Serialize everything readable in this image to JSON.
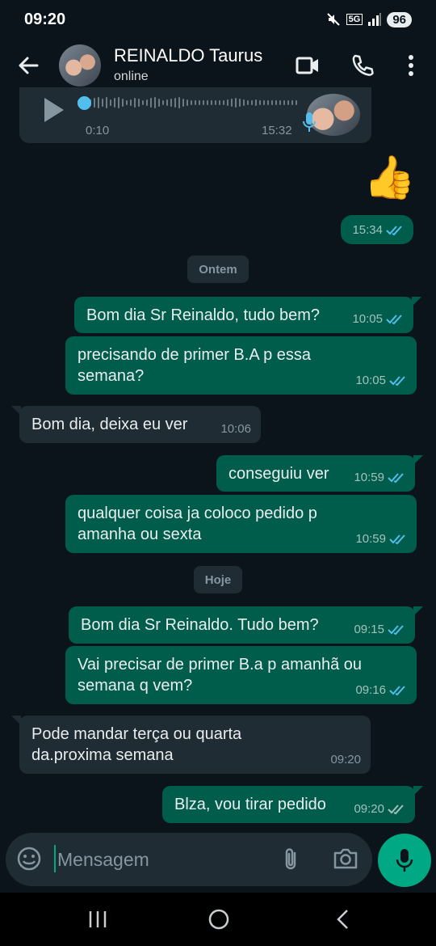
{
  "status_bar": {
    "time": "09:20",
    "network": "5G",
    "battery": "96"
  },
  "header": {
    "contact_name": "REINALDO Taurus",
    "contact_status": "online"
  },
  "audio_message": {
    "duration": "0:10",
    "time": "15:32"
  },
  "emoji_message": {
    "emoji": "👍",
    "time": "15:34"
  },
  "date_separators": {
    "yesterday": "Ontem",
    "today": "Hoje"
  },
  "messages": [
    {
      "text": "Bom dia Sr Reinaldo, tudo bem?",
      "time": "10:05",
      "direction": "out"
    },
    {
      "text": "precisando de primer B.A p essa semana?",
      "time": "10:05",
      "direction": "out"
    },
    {
      "text": "Bom dia, deixa eu ver",
      "time": "10:06",
      "direction": "in"
    },
    {
      "text": "conseguiu ver",
      "time": "10:59",
      "direction": "out"
    },
    {
      "text": "qualquer coisa ja coloco pedido p amanha ou sexta",
      "time": "10:59",
      "direction": "out"
    },
    {
      "text": "Bom dia Sr Reinaldo. Tudo bem?",
      "time": "09:15",
      "direction": "out"
    },
    {
      "text": "Vai precisar de primer B.a p amanhã ou semana q vem?",
      "time": "09:16",
      "direction": "out"
    },
    {
      "text": "Pode mandar terça ou quarta da.proxima semana",
      "time": "09:20",
      "direction": "in"
    },
    {
      "text": "Blza, vou tirar pedido",
      "time": "09:20",
      "direction": "out",
      "read": false
    }
  ],
  "composer": {
    "placeholder": "Mensagem"
  },
  "colors": {
    "background": "#0b141a",
    "outgoing_bubble": "#005c4b",
    "incoming_bubble": "#1f2c34",
    "accent": "#00a884",
    "read_tick": "#53bdeb"
  }
}
